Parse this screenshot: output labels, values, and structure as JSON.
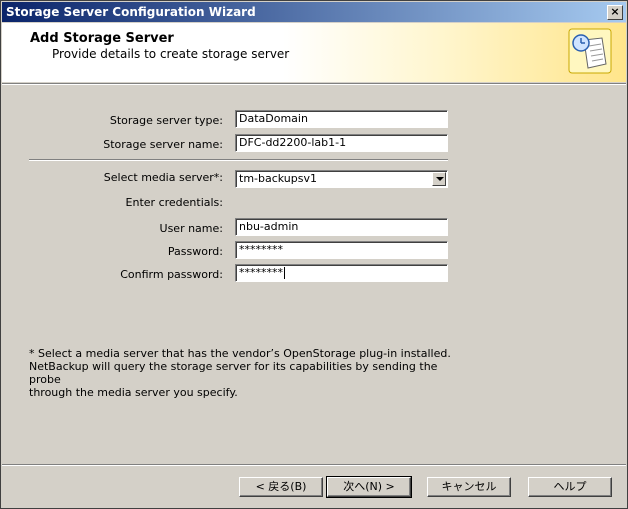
{
  "window": {
    "title": "Storage Server Configuration Wizard",
    "close_label": "×"
  },
  "header": {
    "title": "Add Storage Server",
    "subtitle": "Provide details to create storage server",
    "icon": "wizard-document-clock-icon"
  },
  "form": {
    "storage_server_type": {
      "label": "Storage server type:",
      "value": "DataDomain"
    },
    "storage_server_name": {
      "label": "Storage server name:",
      "value": "DFC-dd2200-lab1-1"
    },
    "media_server": {
      "label": "Select media server*:",
      "value": "tm-backupsv1"
    },
    "credentials_label": "Enter credentials:",
    "user_name": {
      "label": "User name:",
      "value": "nbu-admin"
    },
    "password": {
      "label": "Password:",
      "value": "********"
    },
    "confirm_password": {
      "label": "Confirm password:",
      "value": "********"
    }
  },
  "note": {
    "line1": "* Select a media server that has the vendor’s OpenStorage plug-in installed.",
    "line2": "NetBackup will query the storage server for its capabilities by sending the probe",
    "line3": "through the media server you specify."
  },
  "buttons": {
    "back": "< 戻る(B)",
    "next": "次へ(N) >",
    "cancel": "キャンセル",
    "help": "ヘルプ"
  }
}
